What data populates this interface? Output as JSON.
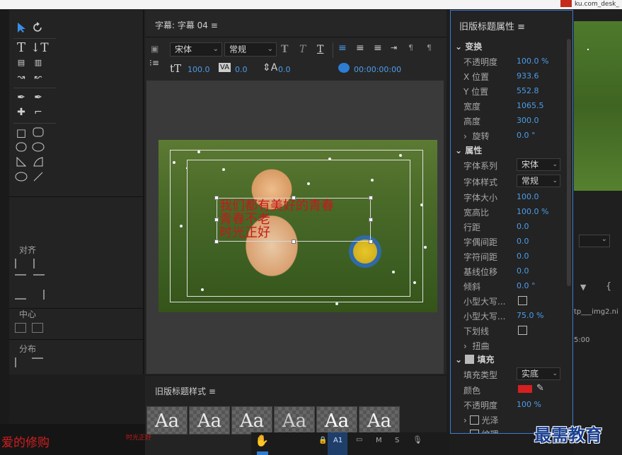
{
  "window": {
    "url_fragment": "ku.com_desk_"
  },
  "tools": {
    "align_label": "对齐",
    "center_label": "中心",
    "distribute_label": "分布"
  },
  "title_panel": {
    "tab_label": "字幕: 字幕 04",
    "font_family": "宋体",
    "font_style": "常规",
    "font_size": "100.0",
    "kerning": "0.0",
    "leading": "0.0",
    "timecode": "00:00:00:00",
    "caption_lines": [
      "我们都有美好的青春",
      "青春不老",
      "时光正好"
    ]
  },
  "styles_panel": {
    "label": "旧版标题样式",
    "swatches": [
      "Aa",
      "Aa",
      "Aa",
      "Aa",
      "Aa",
      "Aa"
    ]
  },
  "properties": {
    "header": "旧版标题属性",
    "transform_section": "变换",
    "opacity_label": "不透明度",
    "opacity": "100.0 %",
    "xpos_label": "X 位置",
    "xpos": "933.6",
    "ypos_label": "Y 位置",
    "ypos": "552.8",
    "width_label": "宽度",
    "width": "1065.5",
    "height_label": "高度",
    "height": "300.0",
    "rotation_label": "旋转",
    "rotation": "0.0 °",
    "attributes_section": "属性",
    "font_family_label": "字体系列",
    "font_family": "宋体",
    "font_style_label": "字体样式",
    "font_style": "常规",
    "font_size_label": "字体大小",
    "font_size": "100.0",
    "aspect_label": "宽高比",
    "aspect": "100.0 %",
    "leading_label": "行距",
    "leading": "0.0",
    "kerning_label": "字偶间距",
    "kerning": "0.0",
    "tracking_label": "字符间距",
    "tracking": "0.0",
    "baseline_label": "基线位移",
    "baseline": "0.0",
    "slant_label": "倾斜",
    "slant": "0.0 °",
    "smallcaps_label": "小型大写...",
    "smallcaps_size_label": "小型大写...",
    "smallcaps_size": "75.0 %",
    "underline_label": "下划线",
    "distort_label": "扭曲",
    "fill_section": "填充",
    "fill_type_label": "填充类型",
    "fill_type": "实底",
    "color_label": "颜色",
    "color_value": "#d42020",
    "fill_opacity_label": "不透明度",
    "fill_opacity": "100 %",
    "sheen_label": "光泽",
    "texture_label": "纹理"
  },
  "right_strip": {
    "clip_name": "tp___img2.ni",
    "time": "5:00"
  },
  "bottom": {
    "red_text": "爱的修购",
    "small_red_text": "时光正好",
    "track_label": "A1",
    "m_label": "M",
    "s_label": "S"
  },
  "watermark": "最需教育"
}
